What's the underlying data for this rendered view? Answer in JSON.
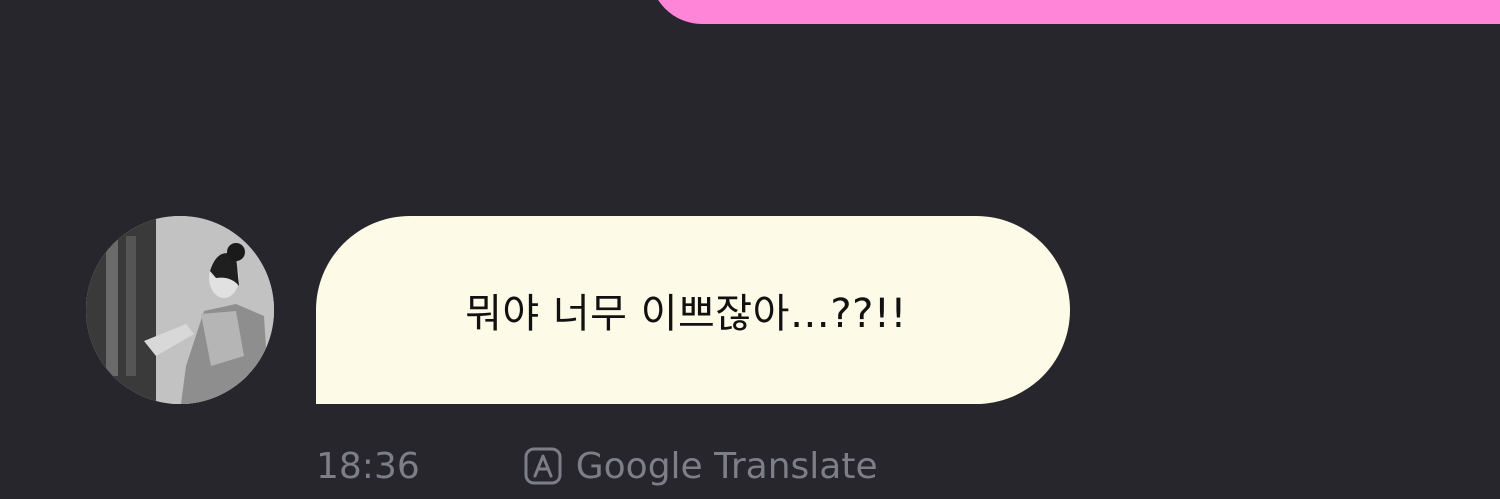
{
  "previous_message": {
    "color": "#ff85d8"
  },
  "message": {
    "text": "뭐야 너무 이쁘잖아…??!!",
    "time": "18:36",
    "bubble_color": "#fdfae7",
    "avatar_icon": "profile-photo-avatar"
  },
  "actions": {
    "translate_icon": "translate-a-icon",
    "translate_label": "Google Translate"
  },
  "colors": {
    "background": "#26262c",
    "meta_text": "#7e7e86"
  }
}
